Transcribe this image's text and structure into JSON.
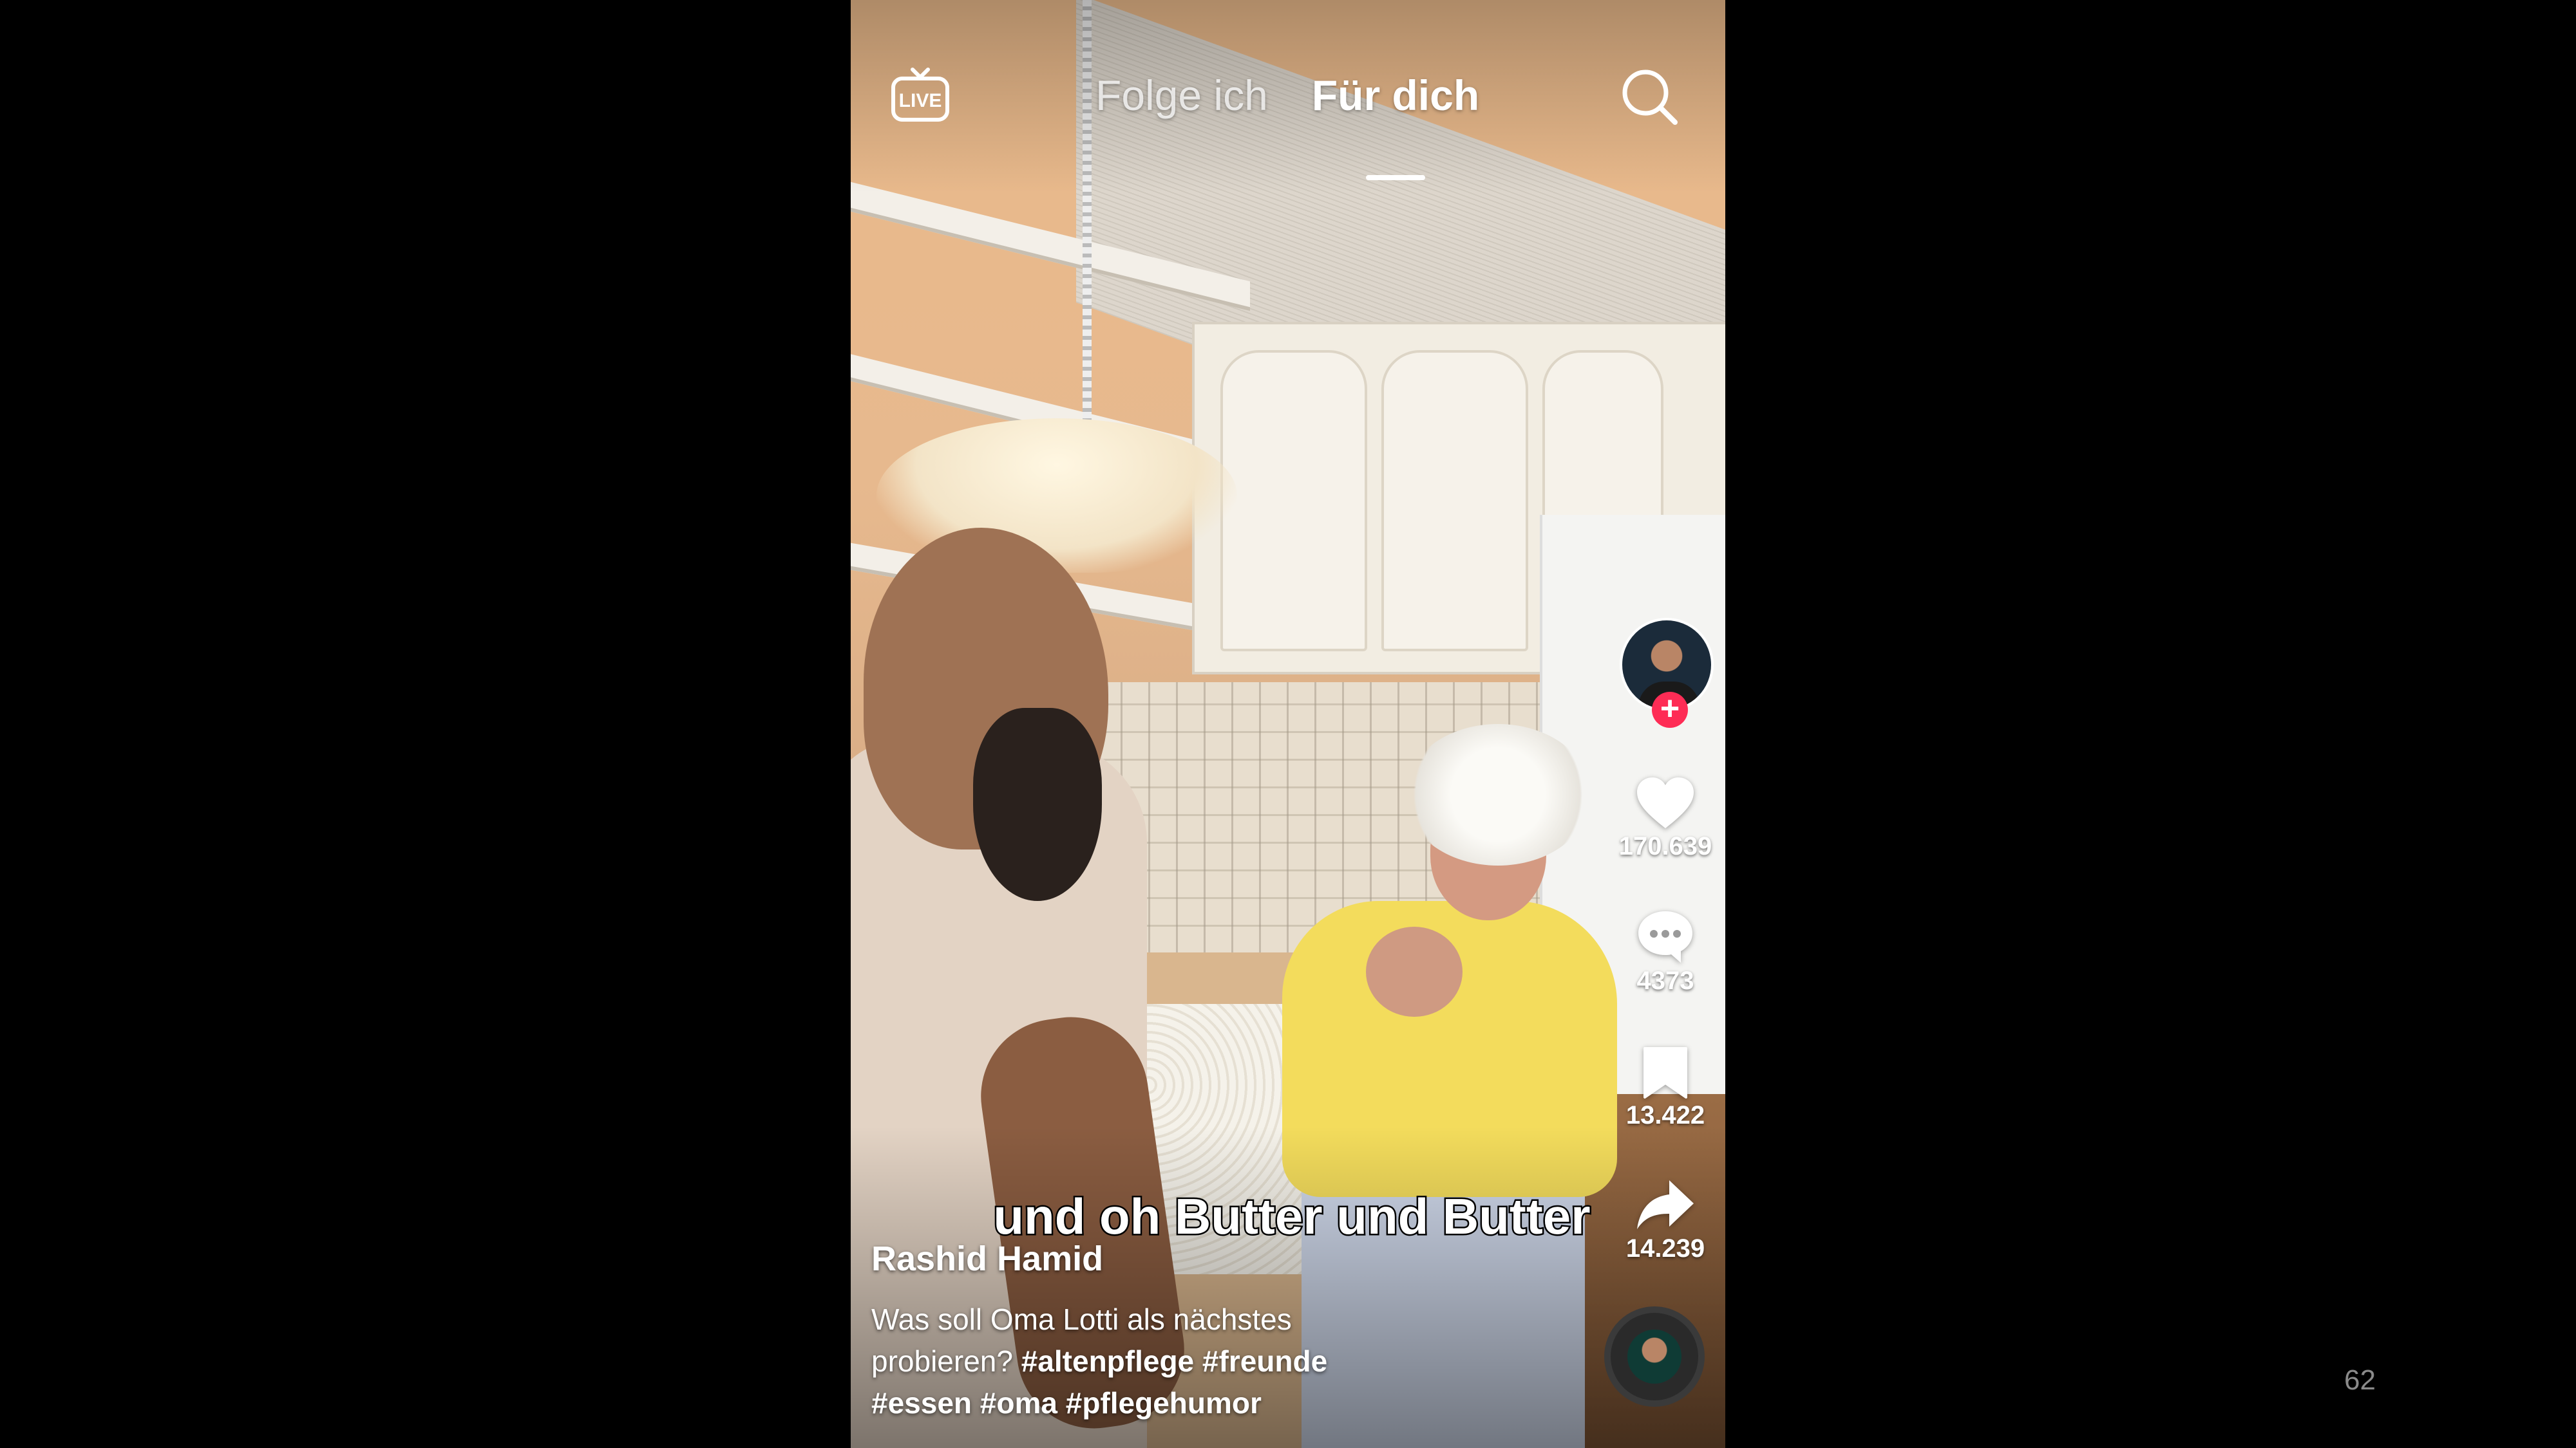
{
  "top_bar": {
    "live_label": "LIVE",
    "tabs": [
      {
        "label": "Folge ich",
        "active": false
      },
      {
        "label": "Für dich",
        "active": true
      }
    ]
  },
  "post": {
    "author": "Rashid Hamid",
    "subtitle": "und oh Butter und Butter",
    "caption_text": "Was soll Oma Lotti als nächstes probieren?",
    "hashtags": [
      "#altenpflege",
      "#freunde",
      "#essen",
      "#oma",
      "#pflegehumor"
    ]
  },
  "actions": {
    "likes": "170.639",
    "comments": "4373",
    "saves": "13.422",
    "shares": "14.239"
  },
  "icons": {
    "live": "live-tv-icon",
    "search": "search-icon",
    "like": "heart-icon",
    "comment": "comment-icon",
    "save": "bookmark-icon",
    "share": "share-arrow-icon",
    "follow": "plus-icon"
  },
  "colors": {
    "accent": "#fe2c55",
    "text": "#ffffff",
    "background": "#000000"
  },
  "slide_number": "62"
}
